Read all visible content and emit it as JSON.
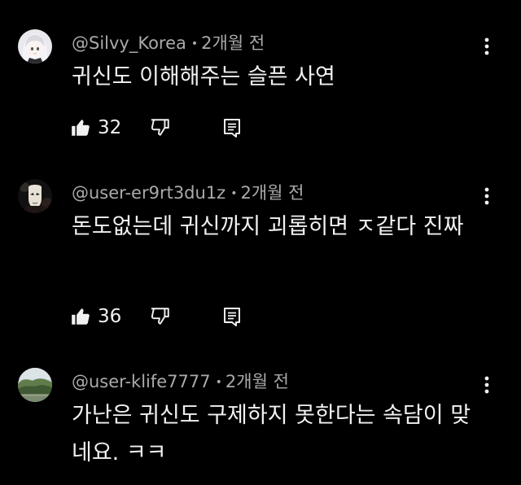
{
  "comments": [
    {
      "author": "@Silvy_Korea",
      "separator": "•",
      "time": "2개월 전",
      "text": "귀신도 이해해주는 슬픈 사연",
      "likes": "32"
    },
    {
      "author": "@user-er9rt3du1z",
      "separator": "•",
      "time": "2개월 전",
      "text": "돈도없는데 귀신까지 괴롭히면 ㅈ같다 진짜",
      "likes": "36"
    },
    {
      "author": "@user-klife7777",
      "separator": "•",
      "time": "2개월 전",
      "text": "가난은 귀신도 구제하지 못한다는 속담이 맞네요. ㅋㅋ"
    }
  ],
  "icons": {
    "like": "thumb-up-icon",
    "dislike": "thumb-down-icon",
    "reply": "comment-reply-icon",
    "more": "more-vertical-icon"
  },
  "colors": {
    "background": "#000000",
    "text": "#f1f1f1",
    "meta": "#aaaaaa"
  }
}
